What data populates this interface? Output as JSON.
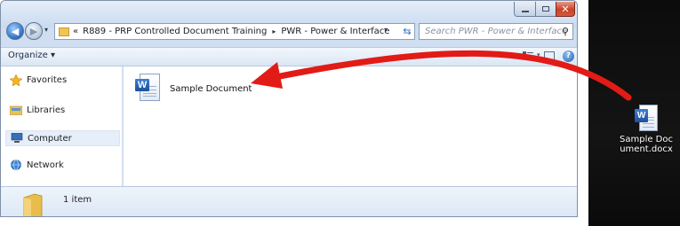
{
  "window": {
    "close_glyph": "✕"
  },
  "nav": {
    "back_glyph": "◀",
    "forward_glyph": "▶",
    "recent_glyph": "▾",
    "address_prefix": "«",
    "address_segments": [
      "R889 - PRP Controlled Document Training",
      "PWR - Power & Interface"
    ],
    "address_separator": "▸",
    "dropdown_glyph": "▾",
    "refresh_glyph": "⇆",
    "search_placeholder": "Search PWR - Power & Interface",
    "search_glyph": "⚲"
  },
  "toolbar": {
    "organize_label": "Organize ▾",
    "view_dropdown_glyph": "▾",
    "help_glyph": "?"
  },
  "sidebar": {
    "items": [
      {
        "label": "Favorites",
        "icon": "star-icon"
      },
      {
        "label": "Libraries",
        "icon": "libraries-icon"
      },
      {
        "label": "Computer",
        "icon": "computer-icon",
        "selected": true
      },
      {
        "label": "Network",
        "icon": "network-icon"
      }
    ]
  },
  "content": {
    "files": [
      {
        "name": "Sample Document",
        "icon": "word-document-icon"
      }
    ]
  },
  "status": {
    "item_count": "1 item"
  },
  "desktop": {
    "file_label": "Sample Document.docx",
    "file_icon": "word-document-icon"
  },
  "icon_glyph": "W",
  "colors": {
    "arrow": "#e21b16",
    "window_frame": "#cfdef0",
    "close_button": "#c7432b",
    "desktop": "#0c0c0c"
  }
}
